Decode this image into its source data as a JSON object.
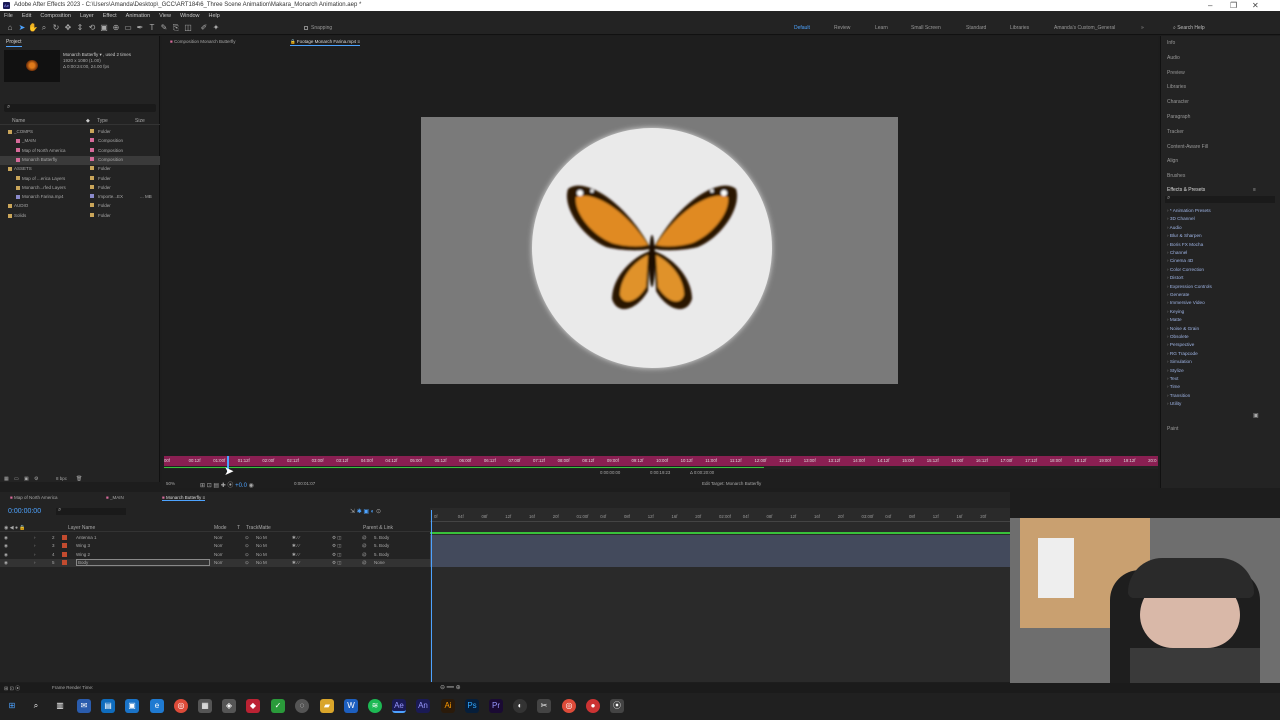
{
  "window": {
    "title": "Adobe After Effects 2023 - C:\\Users\\Amanda\\Desktop\\_GCC\\ART184\\6_Three Scene Animation\\Makara_Monarch Animation.aep *"
  },
  "menu": [
    "File",
    "Edit",
    "Composition",
    "Layer",
    "Effect",
    "Animation",
    "View",
    "Window",
    "Help"
  ],
  "toolbar": {
    "snapping": "Snapping",
    "workspaces": [
      "Default",
      "Review",
      "Learn",
      "Small Screen",
      "Standard",
      "Libraries",
      "Amanda's Custom_General"
    ],
    "search_help": "Search Help"
  },
  "project": {
    "tab": "Project",
    "preview_name": "Monarch Butterfly ▾ , used 2 times",
    "preview_info1": "1920 x 1080 (1.00)",
    "preview_info2": "Δ 0:00:24:00, 24.00 fps",
    "col_name": "Name",
    "col_type": "Type",
    "col_size": "Size",
    "items": [
      {
        "name": "_COMPS",
        "type": "Folder",
        "color": "#c9a55a"
      },
      {
        "name": "_MAIN",
        "type": "Composition",
        "color": "#d66a9a"
      },
      {
        "name": "Map of North America",
        "type": "Composition",
        "color": "#d66a9a"
      },
      {
        "name": "Monarch Butterfly",
        "type": "Composition",
        "color": "#d66a9a"
      },
      {
        "name": "ASSETS",
        "type": "Folder",
        "color": "#c9a55a"
      },
      {
        "name": "Map of ...erica Layers",
        "type": "Folder",
        "color": "#c9a55a"
      },
      {
        "name": "Monarch...rfed Layers",
        "type": "Folder",
        "color": "#c9a55a"
      },
      {
        "name": "Monarch Farina.mp4",
        "type": "Importe...EX",
        "size": "... MB",
        "color": "#8a8acb"
      },
      {
        "name": "AUDIO",
        "type": "Folder",
        "color": "#c9a55a"
      },
      {
        "name": "Solids",
        "type": "Folder",
        "color": "#c9a55a"
      }
    ],
    "bpc": "8 bpc"
  },
  "viewer": {
    "tab_comp": "Composition Monarch Butterfly",
    "tab_footage": "Footage Monarch Farina.mp4",
    "ruler": [
      "00f",
      "00:12f",
      "01:00f",
      "01:12f",
      "02:00f",
      "02:12f",
      "03:00f",
      "03:12f",
      "04:00f",
      "04:12f",
      "05:00f",
      "05:12f",
      "06:00f",
      "06:12f",
      "07:00f",
      "07:12f",
      "08:00f",
      "08:12f",
      "09:00f",
      "09:12f",
      "10:00f",
      "10:12f",
      "11:00f",
      "11:12f",
      "12:00f",
      "12:12f",
      "13:00f",
      "13:12f",
      "14:00f",
      "14:12f",
      "15:00f",
      "15:12f",
      "16:00f",
      "16:12f",
      "17:00f",
      "17:12f",
      "18:00f",
      "18:12f",
      "19:00f",
      "19:12f",
      "20:0"
    ],
    "in_time": "0:00:00:00",
    "out_time": "0:00:19:23",
    "dur_time": "Δ 0:00:20:00",
    "zoom": "50%",
    "time": "0:00:01:07",
    "edit_target": "Edit Target: Monarch Butterfly"
  },
  "right": {
    "panels": [
      "Info",
      "Audio",
      "Preview",
      "Libraries",
      "Character",
      "Paragraph",
      "Tracker",
      "Content-Aware Fill",
      "Align",
      "Brushes"
    ],
    "effects_title": "Effects & Presets",
    "effects": [
      "* Animation Presets",
      "3D Channel",
      "Audio",
      "Blur & Sharpen",
      "Boris FX Mocha",
      "Channel",
      "Cinema 4D",
      "Color Correction",
      "Distort",
      "Expression Controls",
      "Generate",
      "Immersive Video",
      "Keying",
      "Matte",
      "Noise & Grain",
      "Obsolete",
      "Perspective",
      "RG Trapcode",
      "Simulation",
      "Stylize",
      "Text",
      "Time",
      "Transition",
      "Utility"
    ],
    "paint": "Paint"
  },
  "timeline": {
    "tabs": [
      "Map of North America",
      "_MAIN",
      "Monarch Butterfly"
    ],
    "timecode": "0:00:00:00",
    "col_layer": "Layer Name",
    "col_mode": "Mode",
    "col_t": "T",
    "col_track": "TrackMatte",
    "col_parent": "Parent & Link",
    "layers": [
      {
        "num": "2",
        "name": "Antenna 1",
        "mode": "Norr",
        "matte": "No M",
        "parent": "5. Body"
      },
      {
        "num": "3",
        "name": "Wing 3",
        "mode": "Norr",
        "matte": "No M",
        "parent": "5. Body"
      },
      {
        "num": "4",
        "name": "Wing 2",
        "mode": "Norr",
        "matte": "No M",
        "parent": "5. Body"
      },
      {
        "num": "5",
        "name": "Body",
        "mode": "Norr",
        "matte": "No M",
        "parent": "None"
      }
    ],
    "ruler": [
      "0f",
      "04f",
      "08f",
      "12f",
      "16f",
      "20f",
      "01:00f",
      "04f",
      "08f",
      "12f",
      "16f",
      "20f",
      "02:00f",
      "04f",
      "08f",
      "12f",
      "16f",
      "20f",
      "03:00f",
      "04f",
      "08f",
      "12f",
      "16f",
      "20f"
    ],
    "status": "Frame Render Time:"
  },
  "colors": {
    "accent": "#2d8ceb",
    "workarea": "#a23e6e",
    "green": "#38c23b"
  }
}
